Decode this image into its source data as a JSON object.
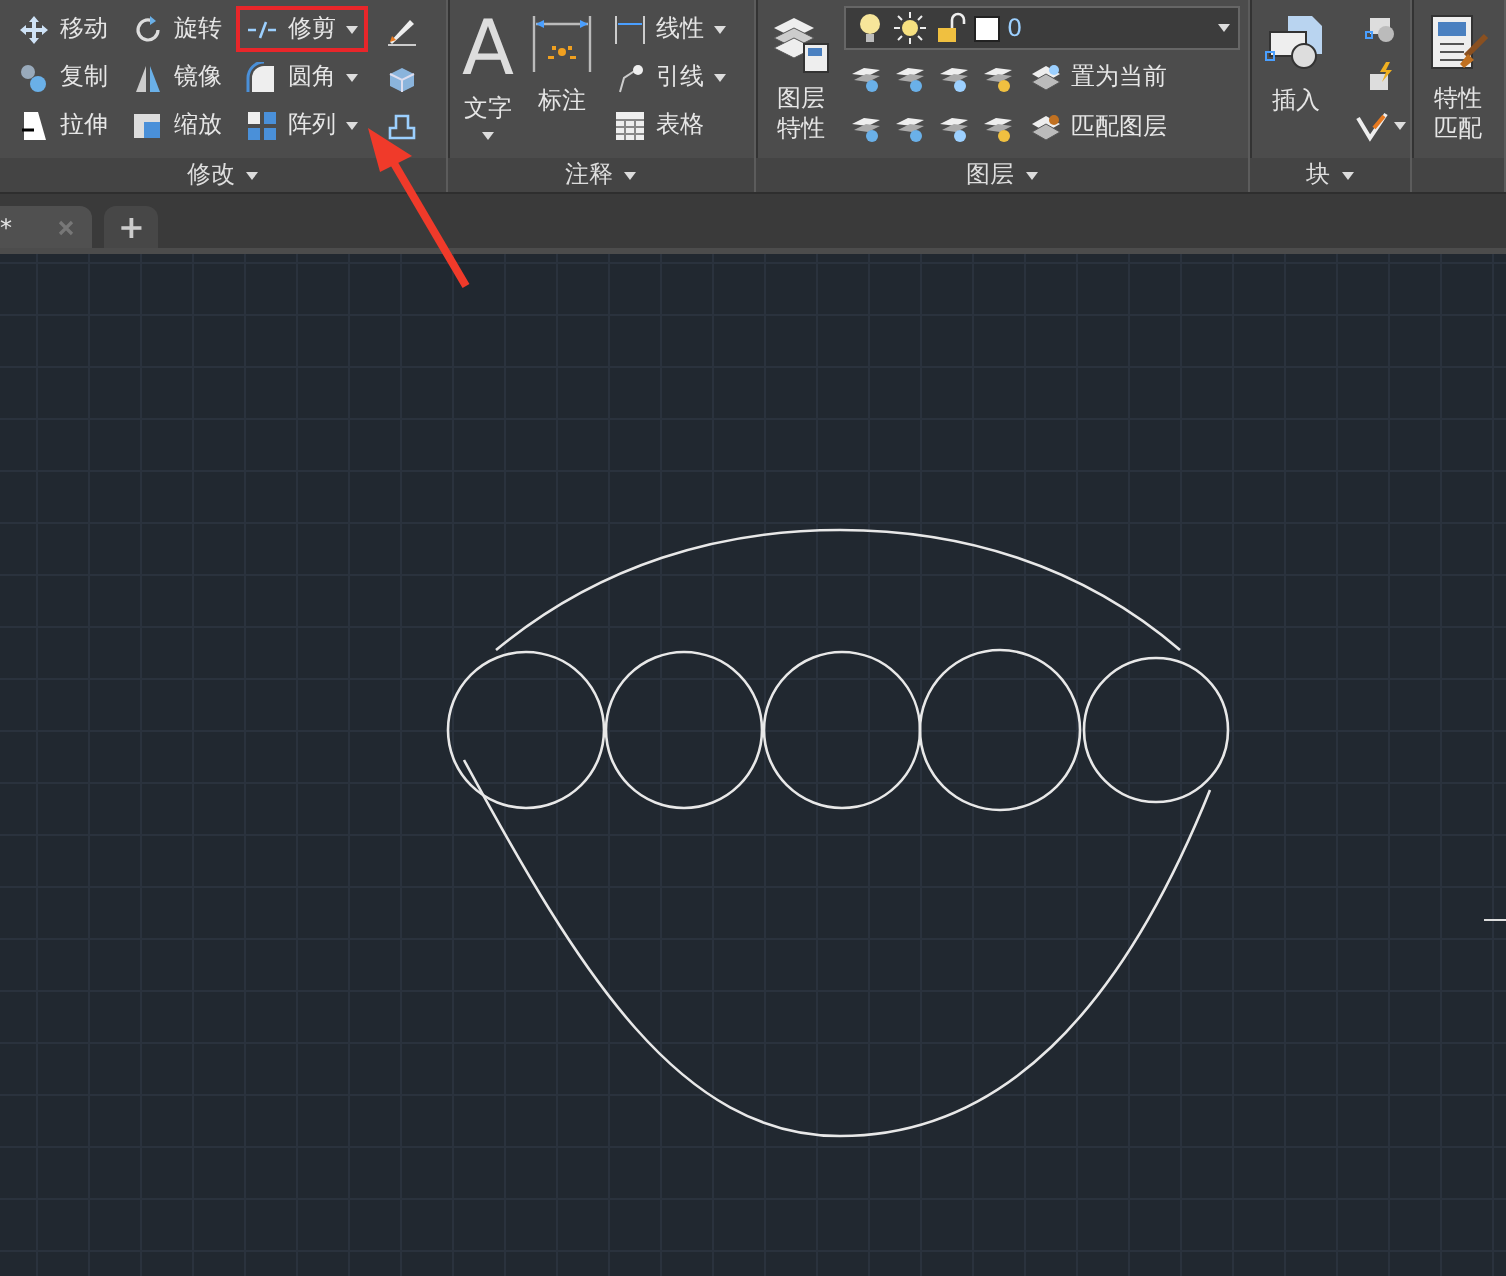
{
  "ribbon": {
    "panels": [
      {
        "title": "修改",
        "kind": "modify",
        "columns": [
          [
            {
              "label": "移动",
              "dropdown": false,
              "highlighted": false
            },
            {
              "label": "复制",
              "dropdown": false,
              "highlighted": false
            },
            {
              "label": "拉伸",
              "dropdown": false,
              "highlighted": false
            }
          ],
          [
            {
              "label": "旋转",
              "dropdown": false,
              "highlighted": false
            },
            {
              "label": "镜像",
              "dropdown": false,
              "highlighted": false
            },
            {
              "label": "缩放",
              "dropdown": false,
              "highlighted": false
            }
          ],
          [
            {
              "label": "修剪",
              "dropdown": true,
              "highlighted": true
            },
            {
              "label": "圆角",
              "dropdown": true,
              "highlighted": false
            },
            {
              "label": "阵列",
              "dropdown": true,
              "highlighted": false
            }
          ]
        ]
      },
      {
        "title": "注释",
        "kind": "annotate",
        "large": [
          {
            "glyph": "A",
            "label": "文字",
            "dropdown": true
          },
          {
            "label": "标注",
            "dropdown": false
          }
        ],
        "small": [
          {
            "label": "线性",
            "dropdown": true
          },
          {
            "label": "引线",
            "dropdown": true
          },
          {
            "label": "表格",
            "dropdown": false
          }
        ]
      },
      {
        "title": "图层",
        "kind": "layers",
        "large": {
          "label": "图层特性"
        },
        "layer_select": {
          "value": "0"
        },
        "rows": [
          {
            "label": "置为当前"
          },
          {
            "label": "匹配图层"
          }
        ]
      },
      {
        "title": "块",
        "kind": "block",
        "large": {
          "label": "插入"
        }
      },
      {
        "kind": "match",
        "large": {
          "label": "特性匹配"
        }
      }
    ]
  },
  "tabs": [
    {
      "label": "*",
      "selected": true
    },
    {
      "label": "+",
      "selected": false
    }
  ]
}
